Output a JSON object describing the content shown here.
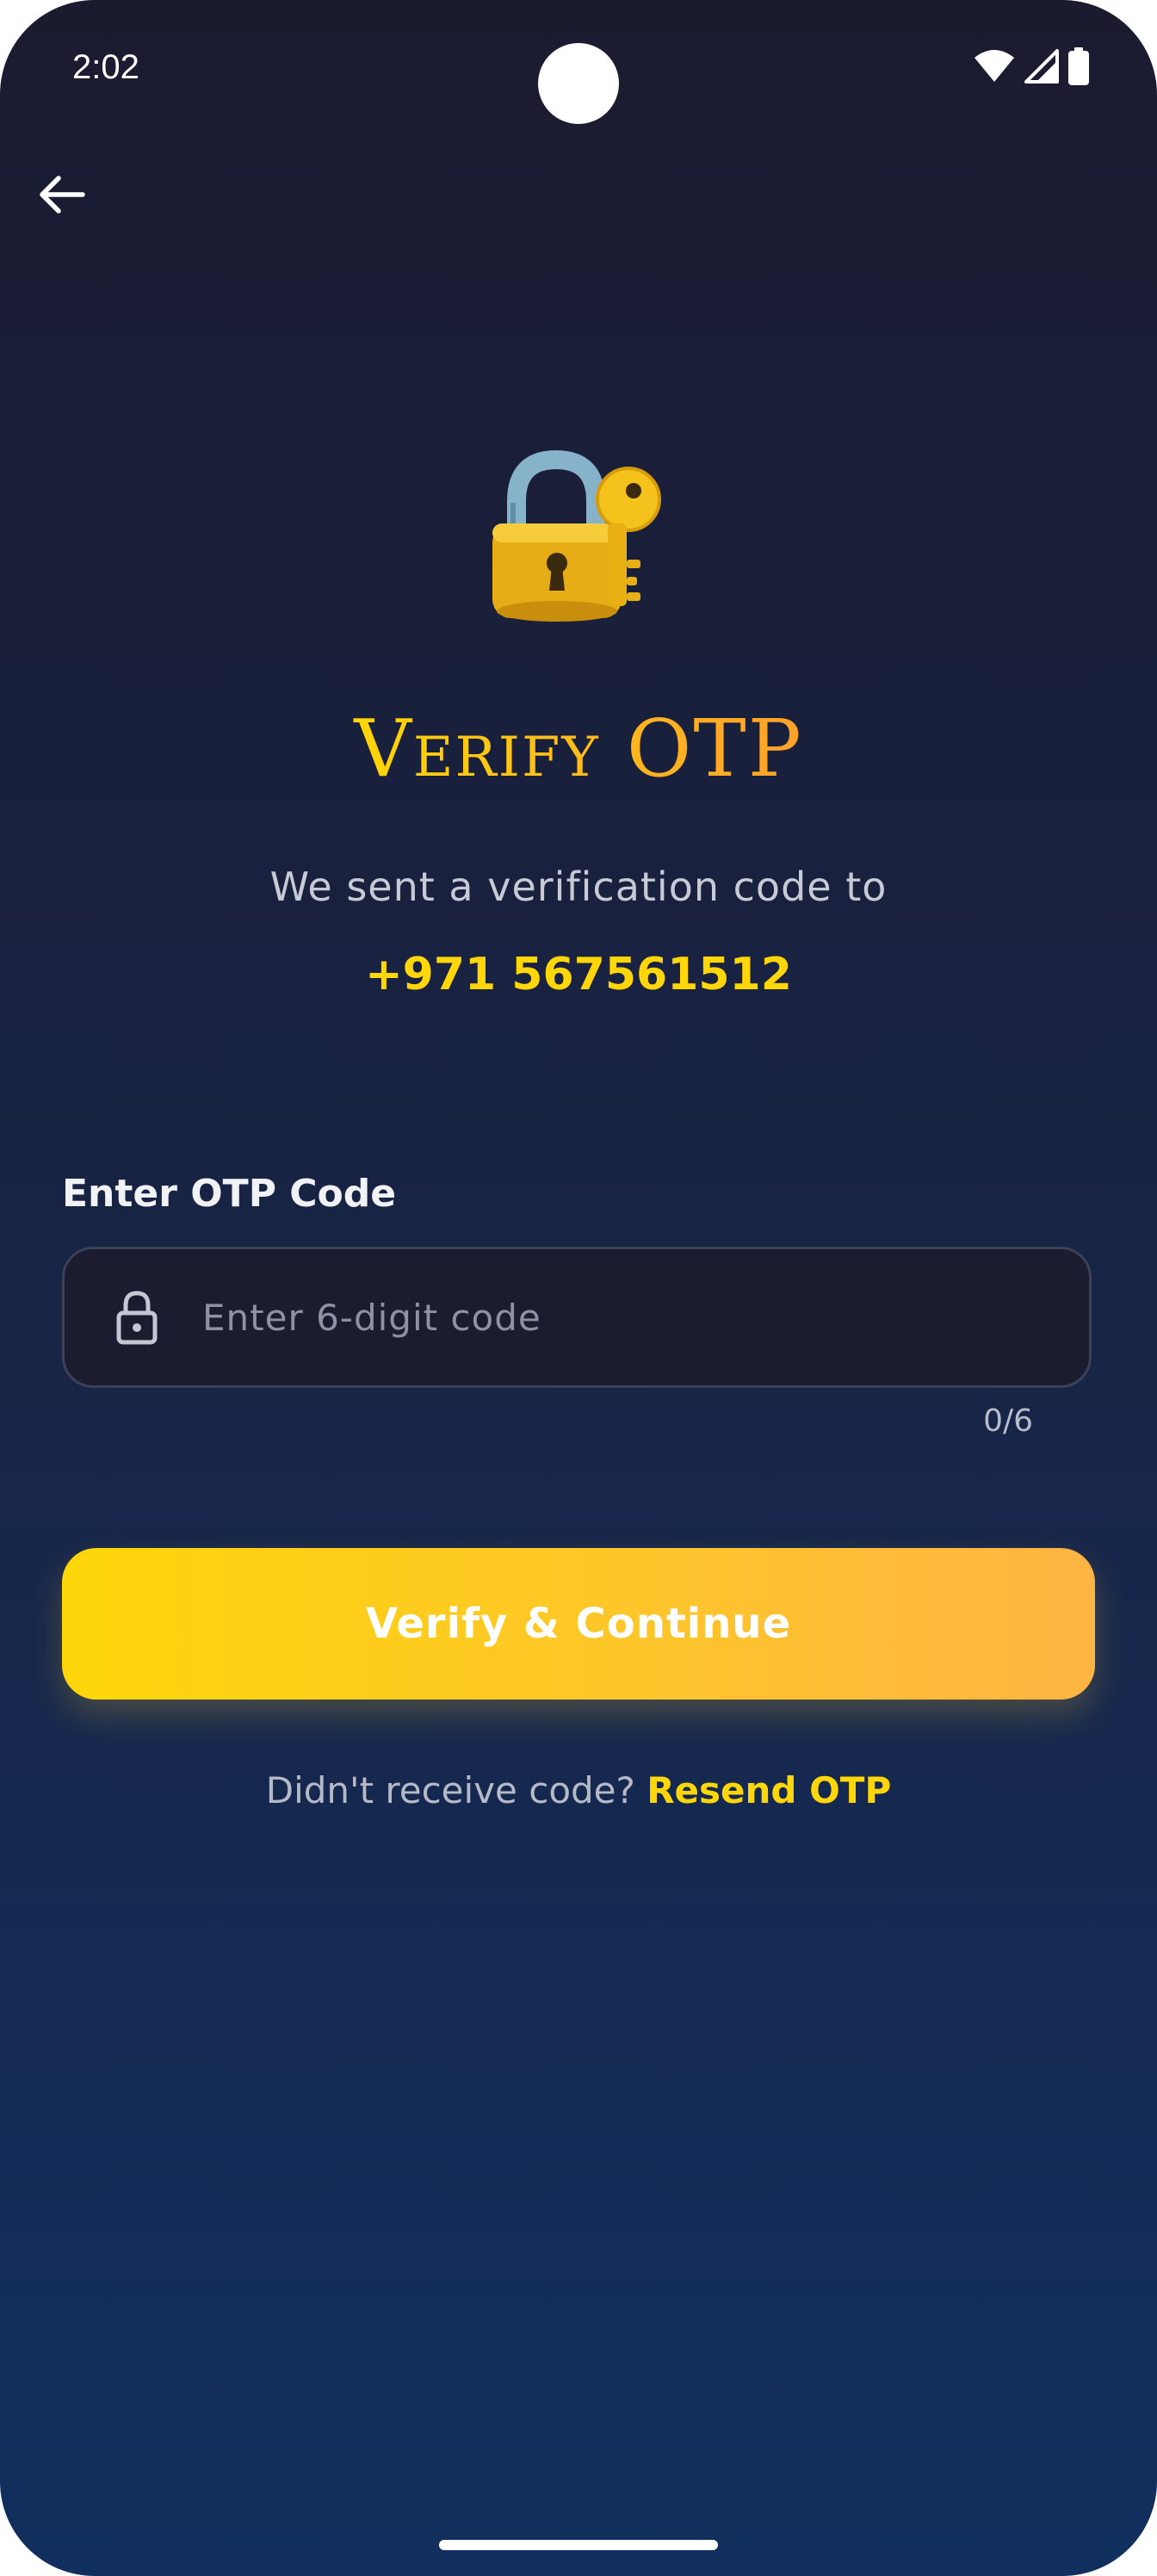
{
  "status_bar": {
    "time": "2:02",
    "icons": [
      "wifi-icon",
      "signal-icon",
      "battery-icon"
    ]
  },
  "header": {
    "back_icon": "arrow-left-icon"
  },
  "hero": {
    "icon": "lock-with-key-icon",
    "title": "Verify OTP",
    "subtitle": "We sent a verification code to",
    "phone": "+971 567561512"
  },
  "otp": {
    "label": "Enter OTP Code",
    "placeholder": "Enter 6-digit code",
    "value": "",
    "counter": "0/6",
    "icon": "lock-icon"
  },
  "actions": {
    "verify_label": "Verify & Continue",
    "resend_prompt": "Didn't receive code?",
    "resend_link": "Resend OTP"
  },
  "colors": {
    "background_top": "#1b1b30",
    "background_bottom": "#112f5e",
    "accent": "#ffd60a",
    "accent_gradient_end": "#fdb443"
  }
}
